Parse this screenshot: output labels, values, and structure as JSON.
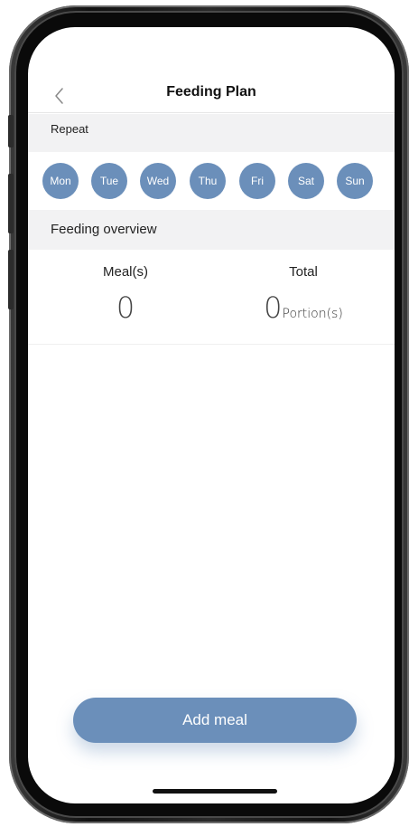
{
  "header": {
    "title": "Feeding Plan",
    "back_icon": "chevron-left-icon"
  },
  "repeat": {
    "label": "Repeat",
    "days": [
      "Mon",
      "Tue",
      "Wed",
      "Thu",
      "Fri",
      "Sat",
      "Sun"
    ]
  },
  "overview": {
    "label": "Feeding overview",
    "meals_label": "Meal(s)",
    "meals_value": "0",
    "total_label": "Total",
    "total_value": "0",
    "total_unit": "Portion(s)"
  },
  "actions": {
    "add_meal": "Add meal"
  },
  "colors": {
    "accent": "#6b8fba",
    "band": "#f2f2f3"
  }
}
